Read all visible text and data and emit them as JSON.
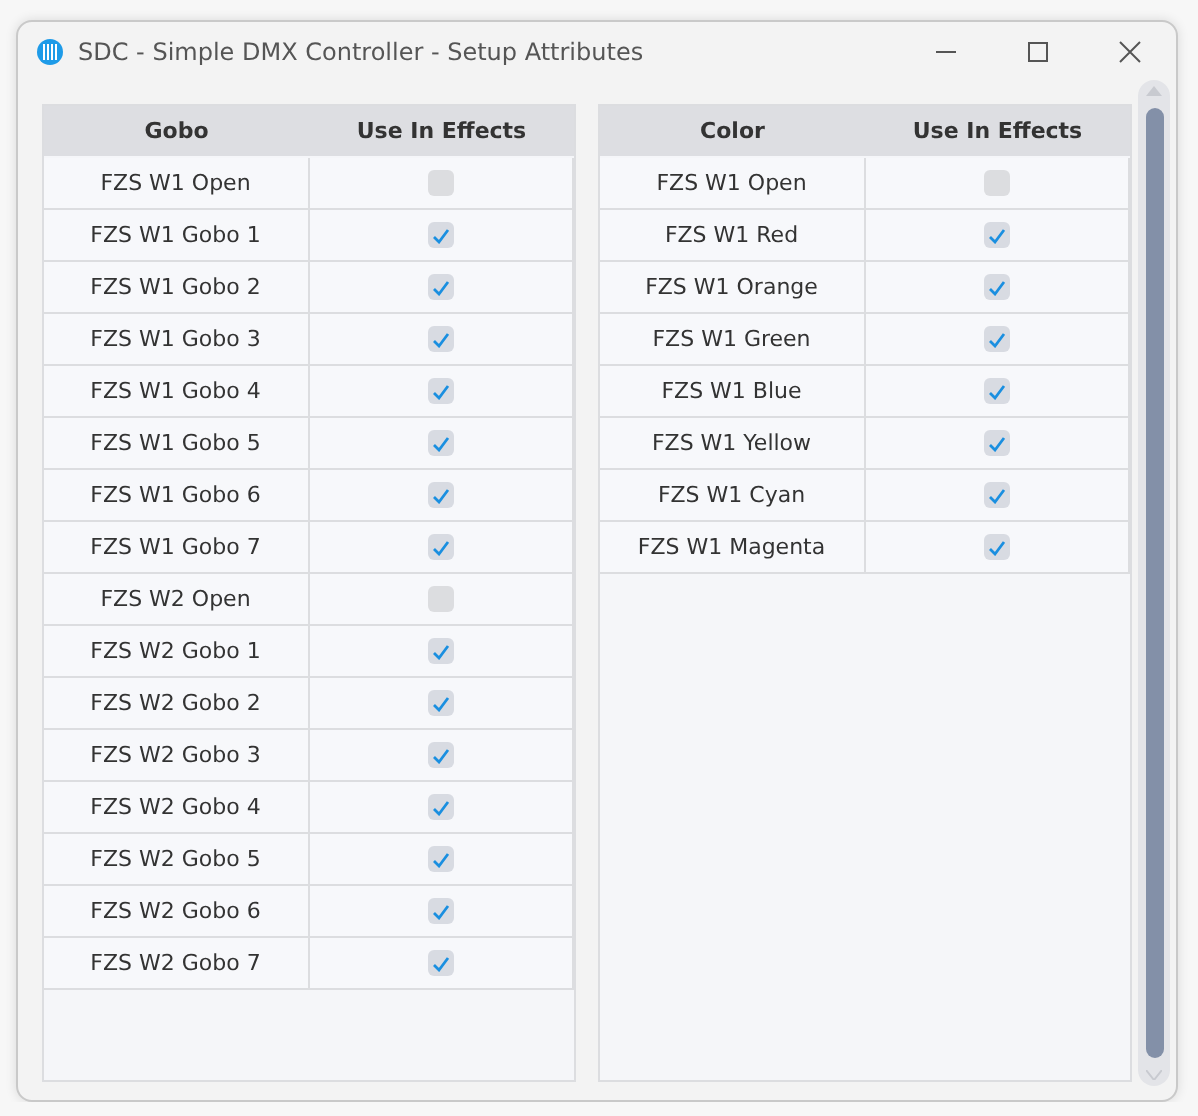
{
  "window": {
    "title": "SDC - Simple DMX Controller - Setup Attributes"
  },
  "tables": [
    {
      "columns": [
        "Gobo",
        "Use In Effects"
      ],
      "rows": [
        {
          "name": "FZS W1 Open",
          "checked": false
        },
        {
          "name": "FZS W1 Gobo 1",
          "checked": true
        },
        {
          "name": "FZS W1 Gobo 2",
          "checked": true
        },
        {
          "name": "FZS W1 Gobo 3",
          "checked": true
        },
        {
          "name": "FZS W1 Gobo 4",
          "checked": true
        },
        {
          "name": "FZS W1 Gobo 5",
          "checked": true
        },
        {
          "name": "FZS W1 Gobo 6",
          "checked": true
        },
        {
          "name": "FZS W1 Gobo 7",
          "checked": true
        },
        {
          "name": "FZS W2 Open",
          "checked": false
        },
        {
          "name": "FZS W2 Gobo 1",
          "checked": true
        },
        {
          "name": "FZS W2 Gobo 2",
          "checked": true
        },
        {
          "name": "FZS W2 Gobo 3",
          "checked": true
        },
        {
          "name": "FZS W2 Gobo 4",
          "checked": true
        },
        {
          "name": "FZS W2 Gobo 5",
          "checked": true
        },
        {
          "name": "FZS W2 Gobo 6",
          "checked": true
        },
        {
          "name": "FZS W2 Gobo 7",
          "checked": true
        }
      ]
    },
    {
      "columns": [
        "Color",
        "Use In Effects"
      ],
      "rows": [
        {
          "name": "FZS W1 Open",
          "checked": false
        },
        {
          "name": "FZS W1 Red",
          "checked": true
        },
        {
          "name": "FZS W1 Orange",
          "checked": true
        },
        {
          "name": "FZS W1 Green",
          "checked": true
        },
        {
          "name": "FZS W1 Blue",
          "checked": true
        },
        {
          "name": "FZS W1 Yellow",
          "checked": true
        },
        {
          "name": "FZS W1 Cyan",
          "checked": true
        },
        {
          "name": "FZS W1 Magenta",
          "checked": true
        }
      ]
    }
  ]
}
